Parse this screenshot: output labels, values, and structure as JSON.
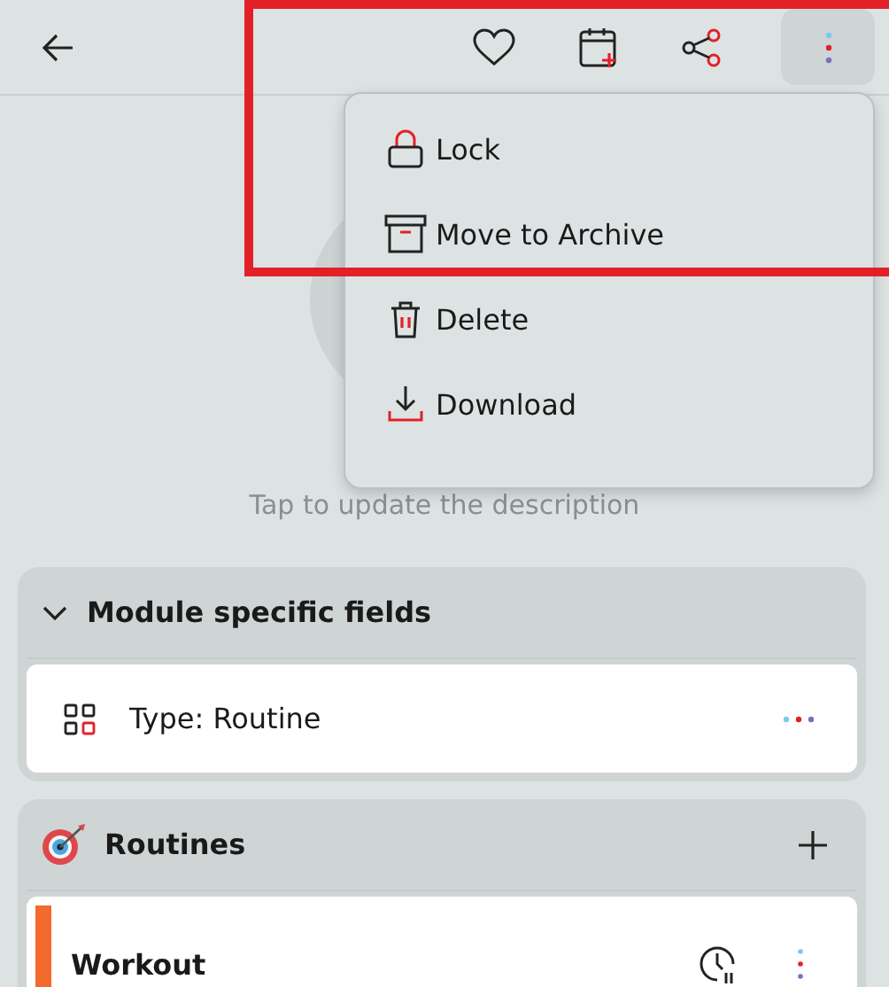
{
  "description_placeholder": "Tap to update the description",
  "menu": {
    "items": [
      {
        "kind": "lock",
        "label": "Lock"
      },
      {
        "kind": "archive",
        "label": "Move to Archive"
      },
      {
        "kind": "delete",
        "label": "Delete"
      },
      {
        "kind": "download",
        "label": "Download"
      }
    ]
  },
  "sections": [
    {
      "kind": "fields",
      "title": "Module specific fields",
      "expanded": true,
      "rows": [
        {
          "label": "Type: Routine"
        }
      ]
    },
    {
      "kind": "routines",
      "title": "Routines",
      "rows": [
        {
          "label": "Workout",
          "color": "#f26a2e"
        }
      ]
    }
  ],
  "highlight": true
}
